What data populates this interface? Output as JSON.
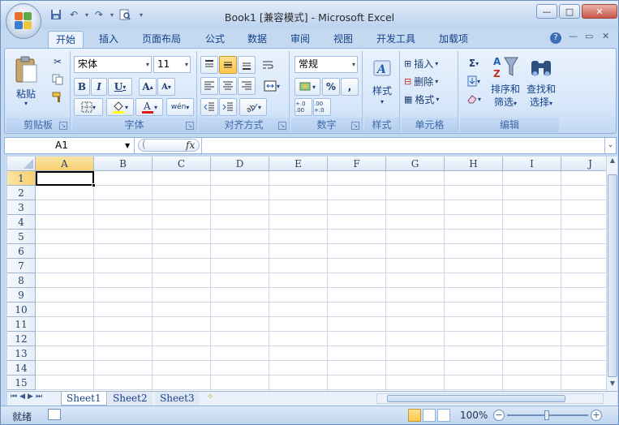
{
  "window": {
    "title": "Book1  [兼容模式] - Microsoft Excel",
    "minimize": "—",
    "maximize": "□",
    "close": "✕"
  },
  "quick_access": [
    "save-icon",
    "undo-icon",
    "redo-icon",
    "print-preview-icon",
    "customize-icon"
  ],
  "tabs": [
    {
      "label": "开始",
      "active": true
    },
    {
      "label": "插入"
    },
    {
      "label": "页面布局"
    },
    {
      "label": "公式"
    },
    {
      "label": "数据"
    },
    {
      "label": "审阅"
    },
    {
      "label": "视图"
    },
    {
      "label": "开发工具"
    },
    {
      "label": "加载项"
    }
  ],
  "ribbon_right": {
    "help": "?",
    "min": "—",
    "restore": "▭",
    "close": "✕"
  },
  "groups": {
    "clipboard": {
      "label": "剪贴板",
      "paste": "粘贴",
      "paste_arrow": "▾"
    },
    "font": {
      "label": "字体",
      "font_name": "宋体",
      "font_size": "11",
      "bold": "B",
      "italic": "I",
      "underline": "U",
      "grow": "A",
      "shrink": "A",
      "phonetic": "wén"
    },
    "alignment": {
      "label": "对齐方式"
    },
    "number": {
      "label": "数字",
      "format": "常规",
      "percent": "%",
      "comma": ",",
      "inc_decimal": "+.0 .00",
      "dec_decimal": ".00 +.0"
    },
    "styles": {
      "label": "样式",
      "button": "样式"
    },
    "cells": {
      "label": "单元格",
      "insert": "插入",
      "delete": "删除",
      "format": "格式"
    },
    "editing": {
      "label": "编辑",
      "sort_filter": "排序和",
      "sort_filter_2": "筛选",
      "find_select": "查找和",
      "find_select_2": "选择"
    }
  },
  "formula_bar": {
    "name_box": "A1",
    "fx": "fx",
    "formula": ""
  },
  "columns": [
    "A",
    "B",
    "C",
    "D",
    "E",
    "F",
    "G",
    "H",
    "I",
    "J"
  ],
  "rows": [
    "1",
    "2",
    "3",
    "4",
    "5",
    "6",
    "7",
    "8",
    "9",
    "10",
    "11",
    "12",
    "13",
    "14",
    "15"
  ],
  "active_cell": "A1",
  "sheets": [
    {
      "label": "Sheet1",
      "active": true
    },
    {
      "label": "Sheet2"
    },
    {
      "label": "Sheet3"
    }
  ],
  "status": {
    "mode": "就绪",
    "zoom": "100%"
  },
  "colors": {
    "ribbon": "#dbe8f9",
    "accent": "#15428b",
    "active_tab_hilite": "#ffd46d"
  }
}
